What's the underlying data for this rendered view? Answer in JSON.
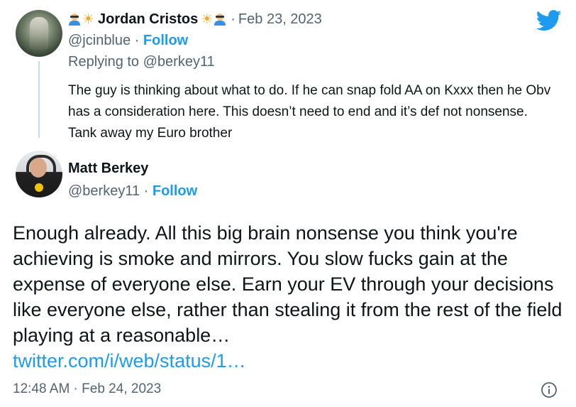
{
  "reply_tweet": {
    "display_name": "Jordan Cristos",
    "name_emoji_left": [
      "person-with-sunglasses-icon",
      "sun-icon"
    ],
    "name_emoji_right": [
      "sun-icon",
      "person-with-sunglasses-icon"
    ],
    "separator": "·",
    "date": "Feb 23, 2023",
    "handle": "@jcinblue",
    "follow_label": "Follow",
    "replying_to": "Replying to @berkey11",
    "text": "The guy is thinking about what to do. If he can snap fold AA on Kxxx then he Obv has a consideration here. This doesn’t need to end and it’s def not nonsense. Tank away my Euro brother"
  },
  "main_tweet": {
    "display_name": "Matt Berkey",
    "handle": "@berkey11",
    "separator": "·",
    "follow_label": "Follow",
    "text": "Enough already. All this big brain nonsense you think you're achieving is smoke and mirrors. You slow fucks gain at the expense of everyone else. Earn your EV through your decisions like everyone else, rather than stealing it from the rest of the field playing at a reasonable…",
    "link": "twitter.com/i/web/status/1…",
    "timestamp": "12:48 AM · Feb 24, 2023"
  },
  "colors": {
    "link_blue": "#1d9bf0",
    "secondary_text": "#536471",
    "primary_text": "#0f1419"
  },
  "icons": {
    "brand": "twitter-bird-icon",
    "info": "info-icon"
  }
}
